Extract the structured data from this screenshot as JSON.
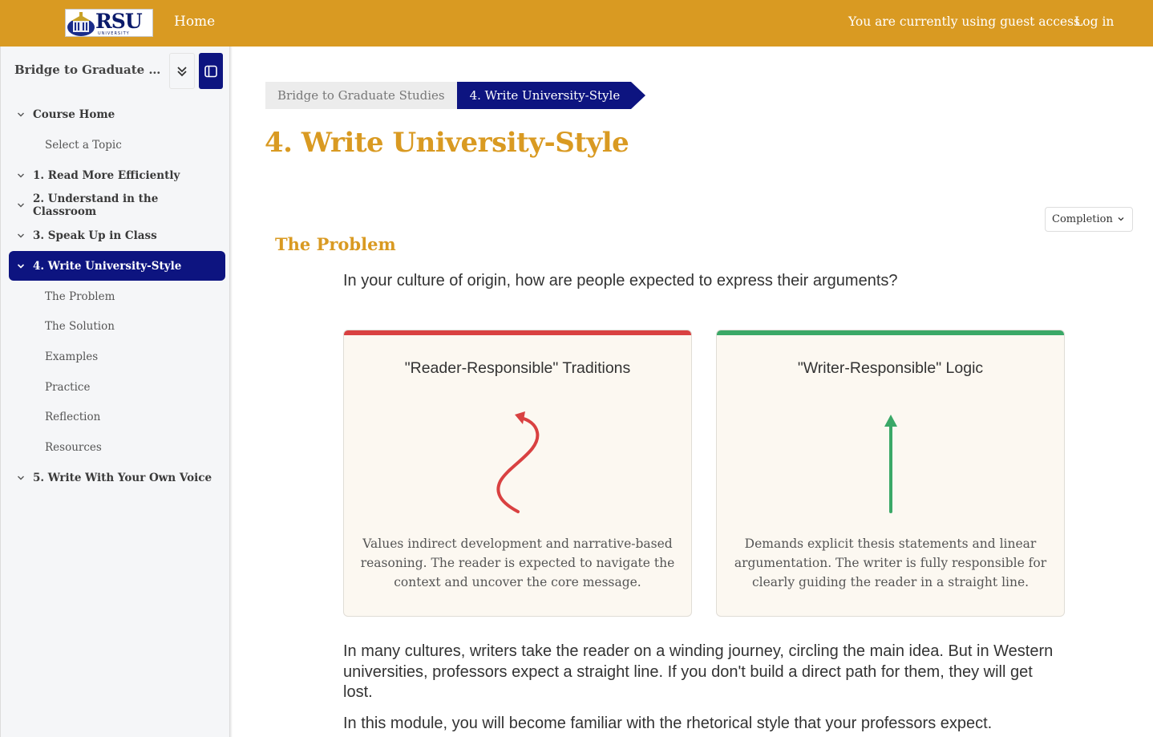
{
  "navbar": {
    "logo_text": "RSU",
    "logo_sub": "UNIVERSITY",
    "home": "Home",
    "guest_notice": "You are currently using guest access",
    "login": "Log in"
  },
  "sidebar": {
    "course_title": "Bridge to Graduate Studies",
    "items": [
      {
        "label": "Course Home"
      },
      {
        "label": "Select a Topic"
      },
      {
        "label": "1. Read More Efficiently"
      },
      {
        "label": "2. Understand in the Classroom"
      },
      {
        "label": "3. Speak Up in Class"
      },
      {
        "label": "4. Write University-Style"
      },
      {
        "label": "The Problem"
      },
      {
        "label": "The Solution"
      },
      {
        "label": "Examples"
      },
      {
        "label": "Practice"
      },
      {
        "label": "Reflection"
      },
      {
        "label": "Resources"
      },
      {
        "label": "5. Write With Your Own Voice"
      }
    ]
  },
  "breadcrumb": {
    "course": "Bridge to Graduate Studies",
    "current": "4. Write University-Style"
  },
  "page": {
    "title": "4. Write University-Style",
    "completion": "Completion",
    "section_title": "The Problem",
    "question": "In your culture of origin, how are people expected to express their arguments?"
  },
  "cards": [
    {
      "title": "\"Reader-Responsible\" Traditions",
      "text": "Values indirect development and narrative-based reasoning. The reader is expected to navigate the context and uncover the core message.",
      "color": "#d94141"
    },
    {
      "title": "\"Writer-Responsible\" Logic",
      "text": "Demands explicit thesis statements and linear argumentation. The writer is fully responsible for clearly guiding the reader in a straight line.",
      "color": "#3aa867"
    }
  ],
  "body": {
    "para1": "In many cultures, writers take the reader on a winding journey, circling the main idea. But in Western universities, professors expect a straight line. If you don't build a direct path for them, they will get lost.",
    "para2": "In this module, you will become familiar with the rhetorical style that your professors expect."
  },
  "colors": {
    "brand_gold": "#d99a22",
    "brand_navy": "#0d1480"
  }
}
